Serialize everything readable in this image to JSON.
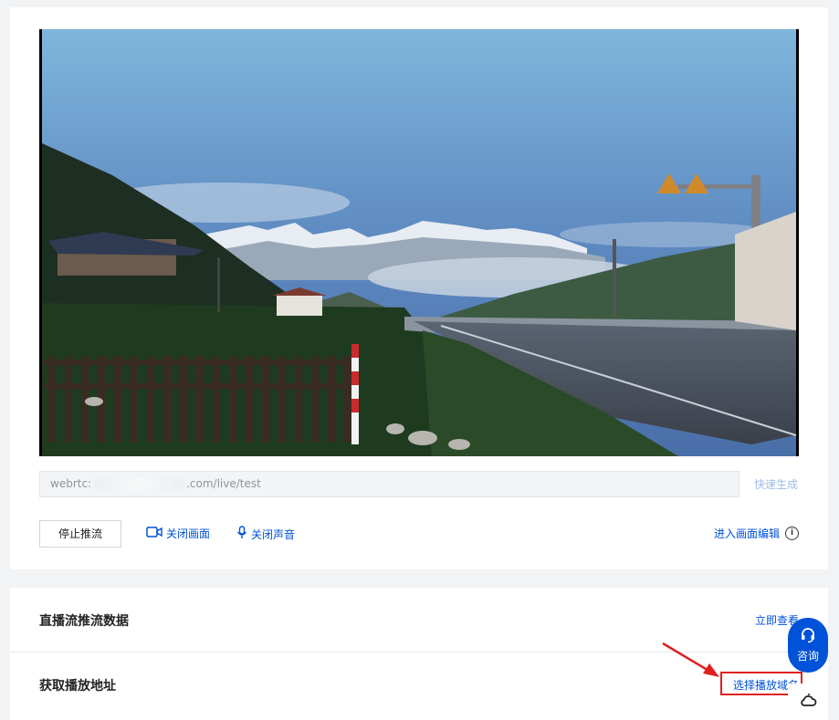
{
  "url_bar": {
    "prefix": "webrtc:",
    "suffix": ".com/live/test"
  },
  "quick_generate": "快速生成",
  "controls": {
    "stop_push": "停止推流",
    "close_video": "关闭画面",
    "close_audio": "关闭声音",
    "enter_edit": "进入画面编辑"
  },
  "rows": {
    "push_data": {
      "title": "直播流推流数据",
      "link": "立即查看"
    },
    "play_url": {
      "title": "获取播放地址",
      "link": "选择播放域名"
    }
  },
  "float": {
    "consult": "咨询"
  },
  "colors": {
    "accent": "#0052d9",
    "highlight": "#e02020",
    "arrow": "#e02020"
  },
  "icons": [
    "camera-icon",
    "microphone-icon",
    "info-icon",
    "headset-icon",
    "cloud-icon"
  ]
}
